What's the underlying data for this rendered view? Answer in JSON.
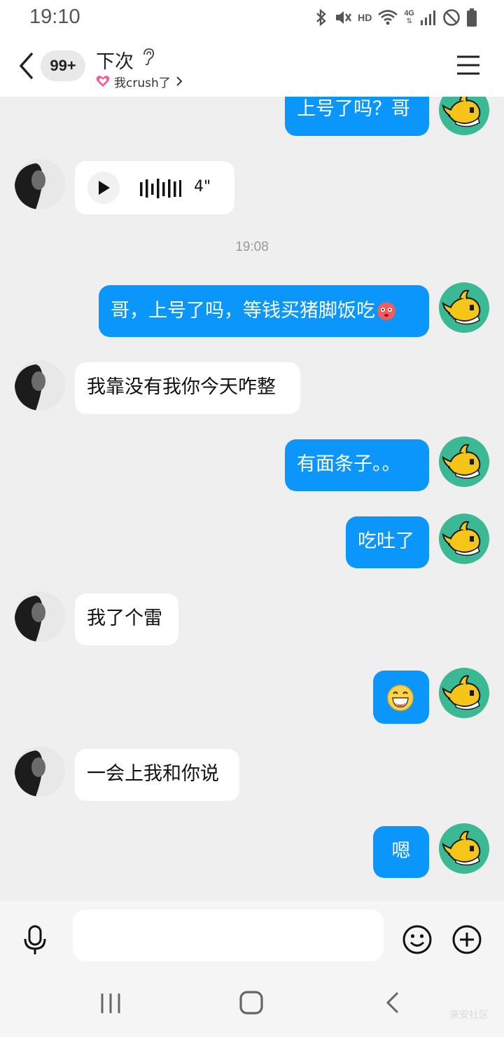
{
  "status_bar": {
    "time": "19:10",
    "icons": [
      "bluetooth-icon",
      "mute-icon",
      "hd-icon",
      "wifi-icon",
      "4g-signal-icon",
      "dnd-icon",
      "battery-icon"
    ],
    "hd_label": "HD",
    "network_label": "4G"
  },
  "header": {
    "unread_badge": "99+",
    "contact_name": "下次",
    "subtitle": "我crush了",
    "icons": [
      "back-icon",
      "ear-icon",
      "heart-icon",
      "chevron-right-icon",
      "menu-icon"
    ]
  },
  "messages": [
    {
      "side": "me",
      "type": "text",
      "text": "上号了吗？哥"
    },
    {
      "side": "them",
      "type": "voice",
      "duration": "4\""
    },
    {
      "type": "timestamp",
      "text": "19:08"
    },
    {
      "side": "me",
      "type": "text",
      "text": "哥，上号了吗，等钱买猪脚饭吃",
      "emoji": "flushed-face-emoji"
    },
    {
      "side": "them",
      "type": "text",
      "text": "我靠没有我你今天咋整"
    },
    {
      "side": "me",
      "type": "text",
      "text": "有面条子。。"
    },
    {
      "side": "me",
      "type": "text",
      "text": "吃吐了"
    },
    {
      "side": "them",
      "type": "text",
      "text": "我了个雷"
    },
    {
      "side": "me",
      "type": "emoji",
      "emoji": "grinning-face-emoji"
    },
    {
      "side": "them",
      "type": "text",
      "text": "一会上我和你说"
    },
    {
      "side": "me",
      "type": "text",
      "text": "嗯"
    }
  ],
  "input_bar": {
    "placeholder": "",
    "icons": [
      "microphone-icon",
      "smiley-icon",
      "plus-icon"
    ]
  },
  "nav_bar": {
    "icons": [
      "recent-apps-icon",
      "home-icon",
      "back-nav-icon"
    ]
  },
  "watermark": "来安社区",
  "colors": {
    "my_bubble": "#0a96fb",
    "their_bubble": "#ffffff",
    "background": "#efefef",
    "my_avatar_bg": "#3bb894"
  }
}
